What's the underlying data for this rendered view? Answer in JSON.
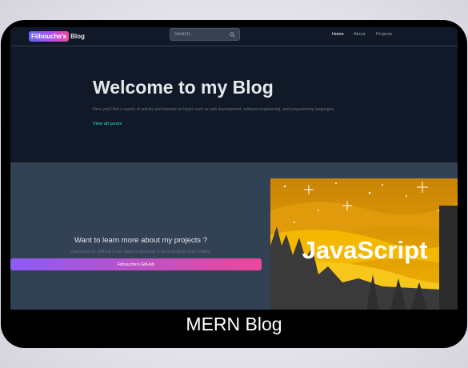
{
  "navbar": {
    "logo_badge": "Fiibouche's",
    "logo_text": "Blog",
    "search_placeholder": "Search...",
    "links": [
      "Home",
      "About",
      "Projects"
    ]
  },
  "hero": {
    "title": "Welcome to my Blog",
    "description": "Here you'll find a variety of articles and tutorials on topics such as web development, software engineering, and programming languages.",
    "link": "View all posts"
  },
  "cta": {
    "title": "Want to learn more about my projects ?",
    "description": "Checkout my GitHub if you want to discover a lot of projects that I made.",
    "button": "Fiibouche's GitHub",
    "image_text": "JavaScript"
  },
  "caption": "MERN Blog",
  "colors": {
    "background": "#111827",
    "section": "#334155",
    "accent": "#14b8a6",
    "gradient_start": "#8b5cf6",
    "gradient_end": "#ec4899"
  },
  "icons": [
    "search-icon"
  ]
}
